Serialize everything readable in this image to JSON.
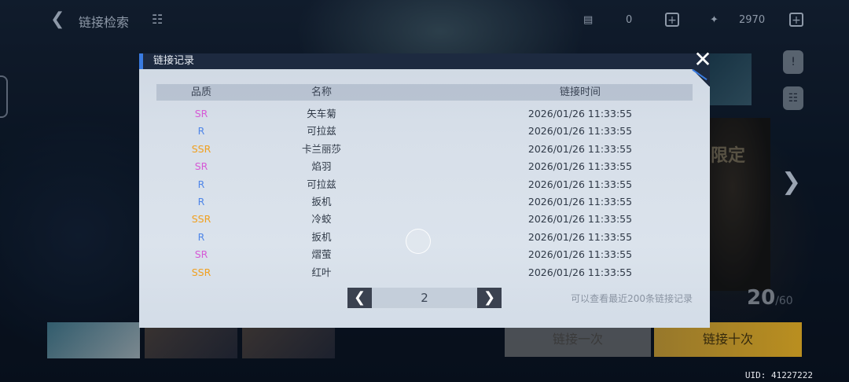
{
  "topbar": {
    "back_icon": "back-arrow-icon",
    "title": "链接检索",
    "tree_icon": "structure-icon",
    "currency1": "0",
    "currency2": "2970"
  },
  "side": {
    "icon1_label": "",
    "icon2_label": ""
  },
  "banner": {
    "limited_text": "限定",
    "count": "20",
    "count_total": "/60"
  },
  "buttons": {
    "pull_one": "链接一次",
    "pull_ten": "链接十次"
  },
  "uid": "UID: 41227222",
  "modal": {
    "title": "链接记录",
    "headers": {
      "quality": "品质",
      "name": "名称",
      "time": "链接时间"
    },
    "rows": [
      {
        "quality": "SR",
        "name": "矢车菊",
        "time": "2026/01/26 11:33:55"
      },
      {
        "quality": "R",
        "name": "可拉兹",
        "time": "2026/01/26 11:33:55"
      },
      {
        "quality": "SSR",
        "name": "卡兰丽莎",
        "time": "2026/01/26 11:33:55"
      },
      {
        "quality": "SR",
        "name": "焰羽",
        "time": "2026/01/26 11:33:55"
      },
      {
        "quality": "R",
        "name": "可拉兹",
        "time": "2026/01/26 11:33:55"
      },
      {
        "quality": "R",
        "name": "扳机",
        "time": "2026/01/26 11:33:55"
      },
      {
        "quality": "SSR",
        "name": "冷蛟",
        "time": "2026/01/26 11:33:55"
      },
      {
        "quality": "R",
        "name": "扳机",
        "time": "2026/01/26 11:33:55"
      },
      {
        "quality": "SR",
        "name": "熠萤",
        "time": "2026/01/26 11:33:55"
      },
      {
        "quality": "SSR",
        "name": "红叶",
        "time": "2026/01/26 11:33:55"
      }
    ],
    "page": "2",
    "note": "可以查看最近200条链接记录"
  },
  "colors": {
    "SSR": "#f0a020",
    "SR": "#d65ad6",
    "R": "#4f86e8"
  }
}
